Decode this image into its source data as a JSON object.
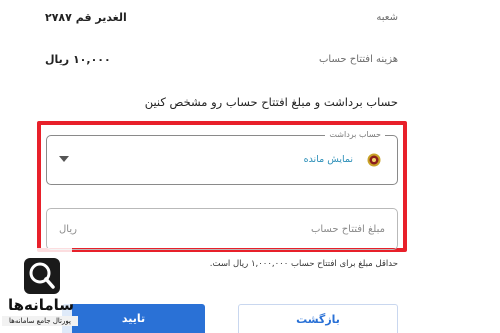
{
  "branch": {
    "label": "شعبه",
    "value": "الغدیر قم ۲۷۸۷"
  },
  "fee": {
    "label": "هزینه افتتاح حساب",
    "value": "۱۰,۰۰۰ ریال"
  },
  "section_title": "حساب برداشت و مبلغ افتتاح حساب رو مشخص کنین",
  "withdrawal_select": {
    "legend": "حساب برداشت",
    "selected": "نمایش مانده",
    "bank_icon": "bank-logo-icon"
  },
  "amount_input": {
    "placeholder": "مبلغ افتتاح حساب",
    "unit": "ریال"
  },
  "hint": "حداقل مبلغ برای افتتاح حساب ۱,۰۰۰,۰۰۰ ریال است.",
  "buttons": {
    "confirm": "تایید",
    "back": "بازگشت"
  },
  "watermark": {
    "name": "سامانه‌ها",
    "tagline": "پورتال جامع سامانه‌ها"
  },
  "colors": {
    "highlight": "#e8202a",
    "accent": "#2a71d6",
    "select_value": "#2c8fb8"
  }
}
